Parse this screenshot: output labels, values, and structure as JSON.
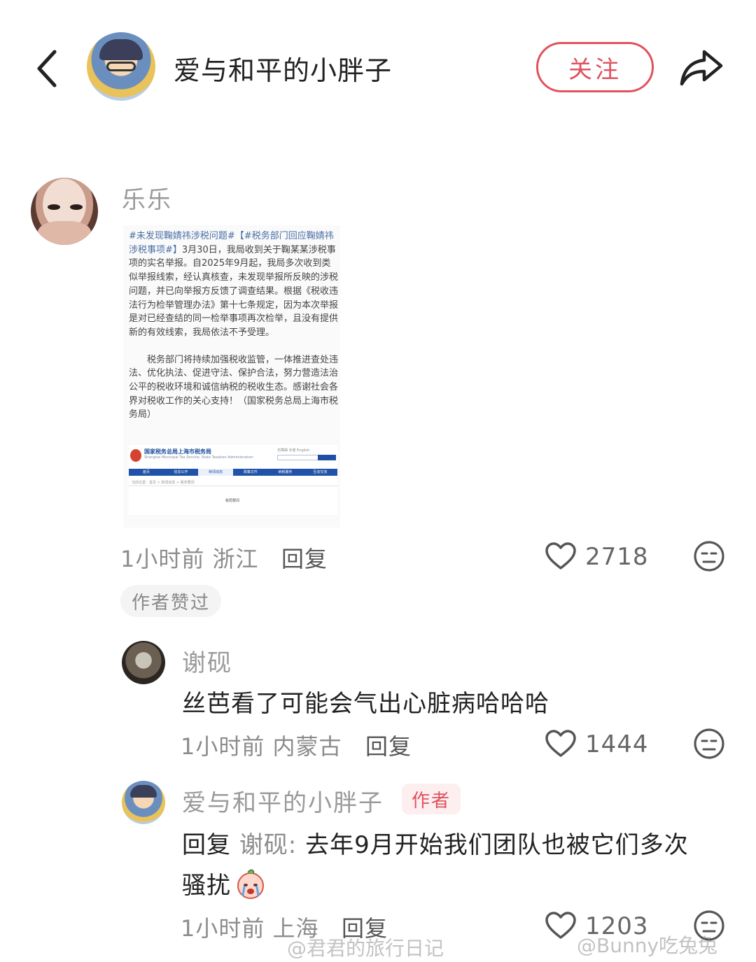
{
  "header": {
    "username": "爱与和平的小胖子",
    "follow_label": "关注",
    "accent_color": "#e0525f"
  },
  "comment": {
    "author": "乐乐",
    "image": {
      "tag1": "#未发现鞠婧祎涉税问题#",
      "tag2": "【#税务部门回应鞠婧祎涉税事项#】",
      "paragraph1_body": "3月30日，我局收到关于鞠某某涉税事项的实名举报。自2025年9月起，我局多次收到类似举报线索，经认真核查，未发现举报所反映的涉税问题，并已向举报方反馈了调查结果。根据《税收违法行为检举管理办法》第十七条规定，因为本次举报是对已经查结的同一检举事项再次检举，且没有提供新的有效线索，我局依法不予受理。",
      "paragraph2": "税务部门将持续加强税收监管，一体推进查处违法、优化执法、促进守法、保护合法，努力营造法治公平的税收环境和诚信纳税的税收生态。感谢社会各界对税收工作的关心支持！（国家税务总局上海市税务局）",
      "site_title": "国家税务总局上海市税务局",
      "site_subtitle": "Shanghai Municipal Tax Service, State Taxation Administration",
      "site_top": "无障碍  长者  English",
      "site_nav": [
        "首页",
        "信息公开",
        "新闻动态",
        "政策文件",
        "纳税服务",
        "互动交流"
      ],
      "site_crumb": "当前位置：首页 > 新闻动态 > 税务要闻",
      "site_label": "税局要闻"
    },
    "time_location": "1小时前 浙江",
    "reply_label": "回复",
    "like_count": "2718",
    "badge": "作者赞过"
  },
  "replies": [
    {
      "author": "谢砚",
      "content": "丝芭看了可能会气出心脏病哈哈哈",
      "time_location": "1小时前 内蒙古",
      "reply_label": "回复",
      "like_count": "1444"
    },
    {
      "author": "爱与和平的小胖子",
      "author_tag": "作者",
      "reply_prefix": "回复",
      "reply_to": "谢砚:",
      "content_line1": "去年9月开始我们团队也被它们多次",
      "content_line2": "骚扰",
      "time_location": "1小时前 上海",
      "reply_label": "回复",
      "like_count": "1203"
    }
  ],
  "watermarks": [
    "@君君的旅行日记",
    "@Bunny吃兔兔"
  ]
}
